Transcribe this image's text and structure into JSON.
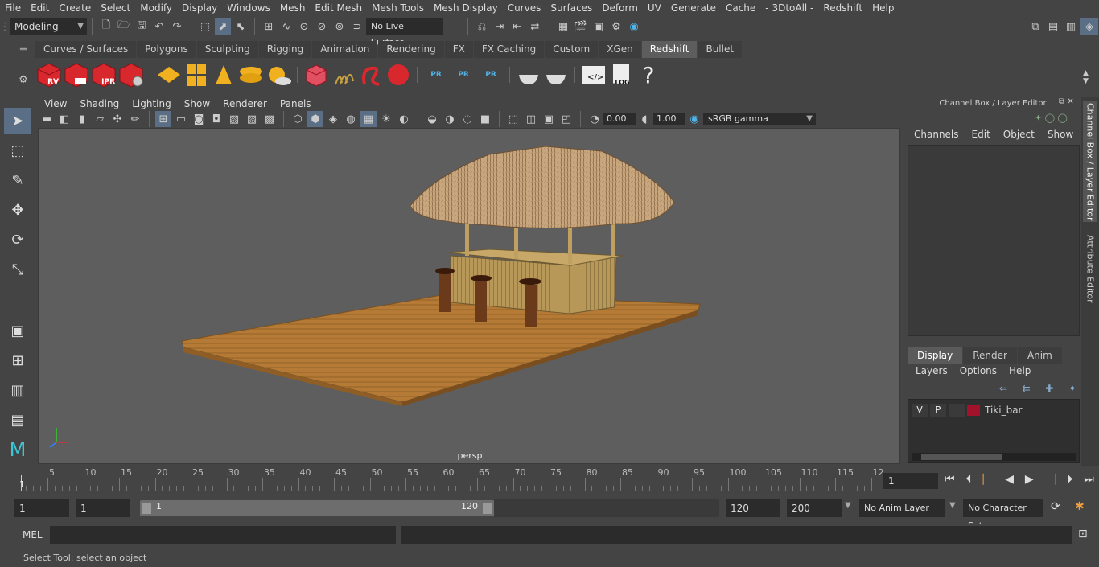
{
  "menu": [
    "File",
    "Edit",
    "Create",
    "Select",
    "Modify",
    "Display",
    "Windows",
    "Mesh",
    "Edit Mesh",
    "Mesh Tools",
    "Mesh Display",
    "Curves",
    "Surfaces",
    "Deform",
    "UV",
    "Generate",
    "Cache",
    "- 3DtoAll -",
    "Redshift",
    "Help"
  ],
  "status": {
    "workspace": "Modeling",
    "live_surface": "No Live Surface"
  },
  "shelf": {
    "tabs": [
      "Curves / Surfaces",
      "Polygons",
      "Sculpting",
      "Rigging",
      "Animation",
      "Rendering",
      "FX",
      "FX Caching",
      "Custom",
      "XGen",
      "Redshift",
      "Bullet"
    ],
    "active_tab": "Redshift",
    "icon_labels": {
      "rv": "RV",
      "ipr": "IPR",
      "pr": "PR",
      "log": ".LOG",
      "help": "?"
    }
  },
  "panel": {
    "menu": [
      "View",
      "Shading",
      "Lighting",
      "Show",
      "Renderer",
      "Panels"
    ],
    "exposure": "0.00",
    "gamma": "1.00",
    "color_space": "sRGB gamma",
    "camera_label": "persp"
  },
  "channel_box": {
    "title": "Channel Box / Layer Editor",
    "menu": [
      "Channels",
      "Edit",
      "Object",
      "Show"
    ]
  },
  "side_tabs": {
    "channel_box": "Channel Box / Layer Editor",
    "attribute_editor": "Attribute Editor"
  },
  "layer_editor": {
    "tabs": [
      "Display",
      "Render",
      "Anim"
    ],
    "active_tab": "Display",
    "menu": [
      "Layers",
      "Options",
      "Help"
    ],
    "layer": {
      "visible": "V",
      "playback": "P",
      "name": "Tiki_bar",
      "color": "#a3122b"
    }
  },
  "timeline": {
    "ticks": [
      "5",
      "10",
      "15",
      "20",
      "25",
      "30",
      "35",
      "40",
      "45",
      "50",
      "55",
      "60",
      "65",
      "70",
      "75",
      "80",
      "85",
      "90",
      "95",
      "100",
      "105",
      "110",
      "115",
      "12"
    ],
    "current_frame_marker": "1",
    "current_frame": "1"
  },
  "range": {
    "start": "1",
    "playback_start": "1",
    "slider_start": "1",
    "slider_end": "120",
    "end": "120",
    "anim_end": "200",
    "anim_layer": "No Anim Layer",
    "character_set": "No Character Set"
  },
  "command": {
    "mode": "MEL"
  },
  "help_line": "Select Tool: select an object",
  "colors": {
    "bg": "#444444",
    "viewport": "#5e5e5e",
    "active_tab": "#5d5d5d",
    "redshift_red": "#d8282e",
    "accent_blue": "#4fb3e8"
  }
}
